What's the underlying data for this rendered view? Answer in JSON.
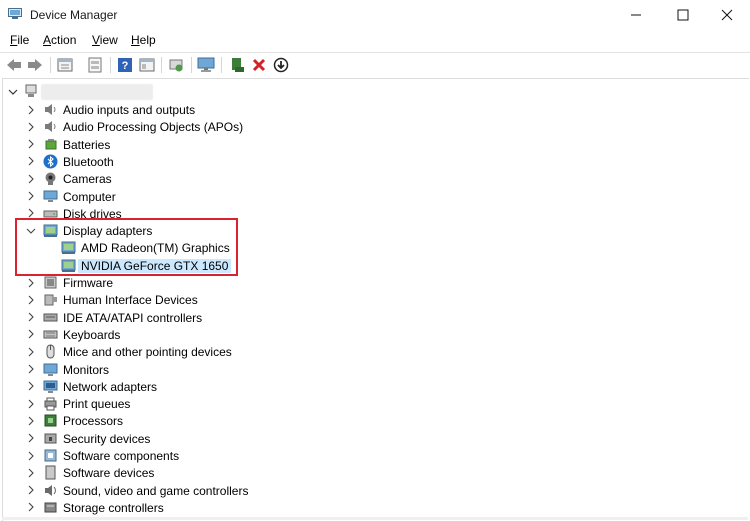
{
  "window": {
    "title": "Device Manager"
  },
  "menu": [
    "File",
    "Action",
    "View",
    "Help"
  ],
  "menu_accel": [
    "F",
    "A",
    "V",
    "H"
  ],
  "toolbar": [
    "back-icon",
    "forward-icon",
    "properties-icon",
    "help-page-icon",
    "help-icon",
    "details-icon",
    "scan-hardware-icon",
    "monitor-icon",
    "add-driver-icon",
    "uninstall-icon",
    "disable-icon"
  ],
  "tree": {
    "categories": [
      {
        "label": "Audio inputs and outputs",
        "icon": "speaker-icon"
      },
      {
        "label": "Audio Processing Objects (APOs)",
        "icon": "speaker-icon"
      },
      {
        "label": "Batteries",
        "icon": "battery-icon"
      },
      {
        "label": "Bluetooth",
        "icon": "bluetooth-icon"
      },
      {
        "label": "Cameras",
        "icon": "camera-icon"
      },
      {
        "label": "Computer",
        "icon": "computer-icon"
      },
      {
        "label": "Disk drives",
        "icon": "disk-icon"
      },
      {
        "label": "Display adapters",
        "icon": "display-adapter-icon",
        "expanded": true,
        "children": [
          {
            "label": "AMD Radeon(TM) Graphics",
            "icon": "display-adapter-icon"
          },
          {
            "label": "NVIDIA GeForce GTX 1650",
            "icon": "display-adapter-icon",
            "selected": true
          }
        ]
      },
      {
        "label": "Firmware",
        "icon": "firmware-icon"
      },
      {
        "label": "Human Interface Devices",
        "icon": "hid-icon"
      },
      {
        "label": "IDE ATA/ATAPI controllers",
        "icon": "ide-icon"
      },
      {
        "label": "Keyboards",
        "icon": "keyboard-icon"
      },
      {
        "label": "Mice and other pointing devices",
        "icon": "mouse-icon"
      },
      {
        "label": "Monitors",
        "icon": "monitor-icon"
      },
      {
        "label": "Network adapters",
        "icon": "network-icon"
      },
      {
        "label": "Print queues",
        "icon": "printer-icon"
      },
      {
        "label": "Processors",
        "icon": "processor-icon"
      },
      {
        "label": "Security devices",
        "icon": "security-icon"
      },
      {
        "label": "Software components",
        "icon": "software-component-icon"
      },
      {
        "label": "Software devices",
        "icon": "software-device-icon"
      },
      {
        "label": "Sound, video and game controllers",
        "icon": "sound-icon"
      },
      {
        "label": "Storage controllers",
        "icon": "storage-icon"
      }
    ]
  },
  "colors": {
    "selection": "#cce8ff",
    "highlight_box": "#d9232e"
  }
}
